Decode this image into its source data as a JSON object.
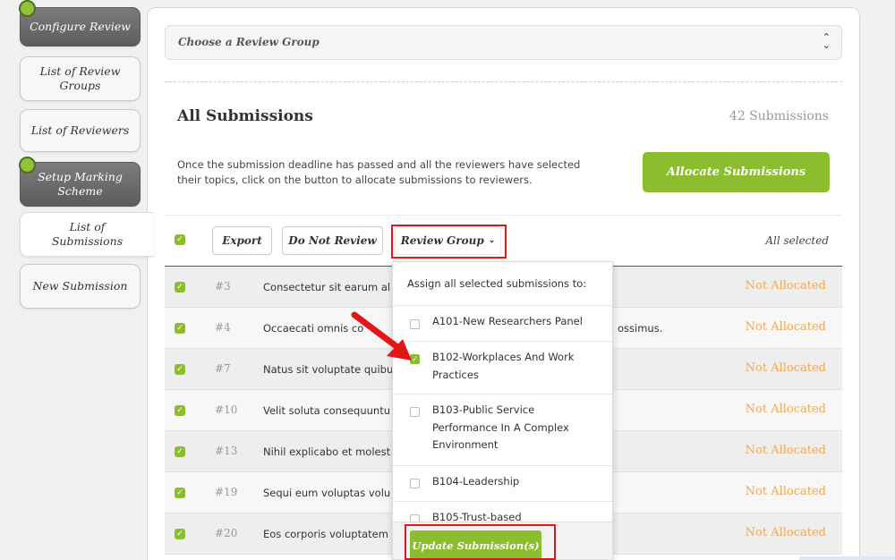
{
  "sidebar": {
    "items": [
      {
        "label": "Configure Review"
      },
      {
        "label": "List of Review Groups"
      },
      {
        "label": "List of Reviewers"
      },
      {
        "label": "Setup Marking Scheme"
      },
      {
        "label": "List of Submissions"
      },
      {
        "label": "New Submission"
      }
    ]
  },
  "filter": {
    "placeholder": "Choose a Review Group",
    "arrows": "⌃⌄"
  },
  "section": {
    "title": "All Submissions",
    "count": "42 Submissions",
    "description": "Once the submission deadline has passed and all the reviewers have selected their topics, click on the button to allocate submissions to reviewers.",
    "allocate_label": "Allocate Submissions"
  },
  "toolbar": {
    "export_label": "Export",
    "do_not_review_label": "Do Not Review",
    "review_group_label": "Review Group",
    "all_selected": "All selected"
  },
  "rows": [
    {
      "num": "#3",
      "text": "Consectetur sit earum al",
      "tail": "",
      "status": "Not Allocated"
    },
    {
      "num": "#4",
      "text": "Occaecati omnis co",
      "tail": "ossimus.",
      "status": "Not Allocated"
    },
    {
      "num": "#7",
      "text": "Natus sit voluptate quibu",
      "tail": "",
      "status": "Not Allocated"
    },
    {
      "num": "#10",
      "text": "Velit soluta consequuntu",
      "tail": "",
      "status": "Not Allocated"
    },
    {
      "num": "#13",
      "text": "Nihil explicabo et molest",
      "tail": "",
      "status": "Not Allocated"
    },
    {
      "num": "#19",
      "text": "Sequi eum voluptas volu",
      "tail": "",
      "status": "Not Allocated"
    },
    {
      "num": "#20",
      "text": "Eos corporis voluptatem",
      "tail": "",
      "status": "Not Allocated"
    }
  ],
  "dropdown": {
    "heading": "Assign all selected submissions to:",
    "options": [
      {
        "label": "A101-New Researchers Panel",
        "checked": false
      },
      {
        "label": "B102-Workplaces And Work Practices",
        "checked": true
      },
      {
        "label": "B103-Public Service Performance In A Complex Environment",
        "checked": false
      },
      {
        "label": "B104-Leadership",
        "checked": false
      },
      {
        "label": "B105-Trust-based",
        "checked": false
      }
    ],
    "update_label": "Update Submission(s)"
  },
  "colors": {
    "accent": "#8cbd2e",
    "status": "#f5a84a",
    "highlight": "#e3151a"
  }
}
